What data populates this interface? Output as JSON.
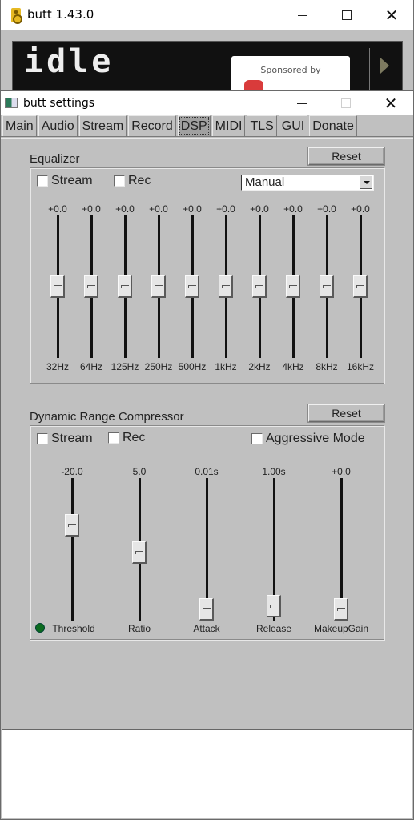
{
  "main_window": {
    "title": "butt 1.43.0",
    "app_icon": "speaker-icon",
    "status_display": "idle",
    "sponsor_label": "Sponsored by",
    "sponsor_logo": "radio-co-logo",
    "play_icon": "play-icon"
  },
  "settings_window": {
    "title": "butt settings",
    "tabs": [
      {
        "label": "Main",
        "active": false
      },
      {
        "label": "Audio",
        "active": false
      },
      {
        "label": "Stream",
        "active": false
      },
      {
        "label": "Record",
        "active": false
      },
      {
        "label": "DSP",
        "active": true
      },
      {
        "label": "MIDI",
        "active": false
      },
      {
        "label": "TLS",
        "active": false
      },
      {
        "label": "GUI",
        "active": false
      },
      {
        "label": "Donate",
        "active": false
      }
    ],
    "equalizer": {
      "label": "Equalizer",
      "reset_label": "Reset",
      "stream_label": "Stream",
      "stream_checked": false,
      "rec_label": "Rec",
      "rec_checked": false,
      "preset": "Manual",
      "bands": [
        {
          "freq": "32Hz",
          "value": "+0.0"
        },
        {
          "freq": "64Hz",
          "value": "+0.0"
        },
        {
          "freq": "125Hz",
          "value": "+0.0"
        },
        {
          "freq": "250Hz",
          "value": "+0.0"
        },
        {
          "freq": "500Hz",
          "value": "+0.0"
        },
        {
          "freq": "1kHz",
          "value": "+0.0"
        },
        {
          "freq": "2kHz",
          "value": "+0.0"
        },
        {
          "freq": "4kHz",
          "value": "+0.0"
        },
        {
          "freq": "8kHz",
          "value": "+0.0"
        },
        {
          "freq": "16kHz",
          "value": "+0.0"
        }
      ],
      "band_position_fraction": 0.5
    },
    "compressor": {
      "label": "Dynamic Range Compressor",
      "reset_label": "Reset",
      "stream_label": "Stream",
      "stream_checked": false,
      "rec_label": "Rec",
      "rec_checked": false,
      "aggressive_label": "Aggressive Mode",
      "aggressive_checked": false,
      "led_color": "#0b6b1e",
      "sliders": [
        {
          "name": "Threshold",
          "value": "-20.0",
          "position_fraction": 0.33
        },
        {
          "name": "Ratio",
          "value": "5.0",
          "position_fraction": 0.52
        },
        {
          "name": "Attack",
          "value": "0.01s",
          "position_fraction": 0.98
        },
        {
          "name": "Release",
          "value": "1.00s",
          "position_fraction": 0.9
        },
        {
          "name": "MakeupGain",
          "value": "+0.0",
          "position_fraction": 0.98
        }
      ]
    }
  }
}
